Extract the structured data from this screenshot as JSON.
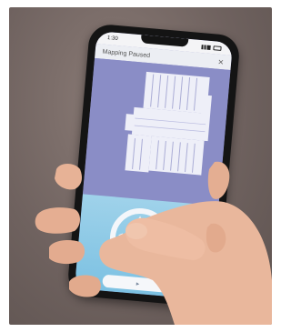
{
  "phone": {
    "status_time": "1:30",
    "header_title": "Mapping Paused",
    "close_icon": "close-icon",
    "button_icon": "play-icon"
  },
  "colors": {
    "background": "#6f625f",
    "map": "#8a8dc6",
    "controls": "#8ccbe6",
    "skin": "#e8b89e"
  }
}
